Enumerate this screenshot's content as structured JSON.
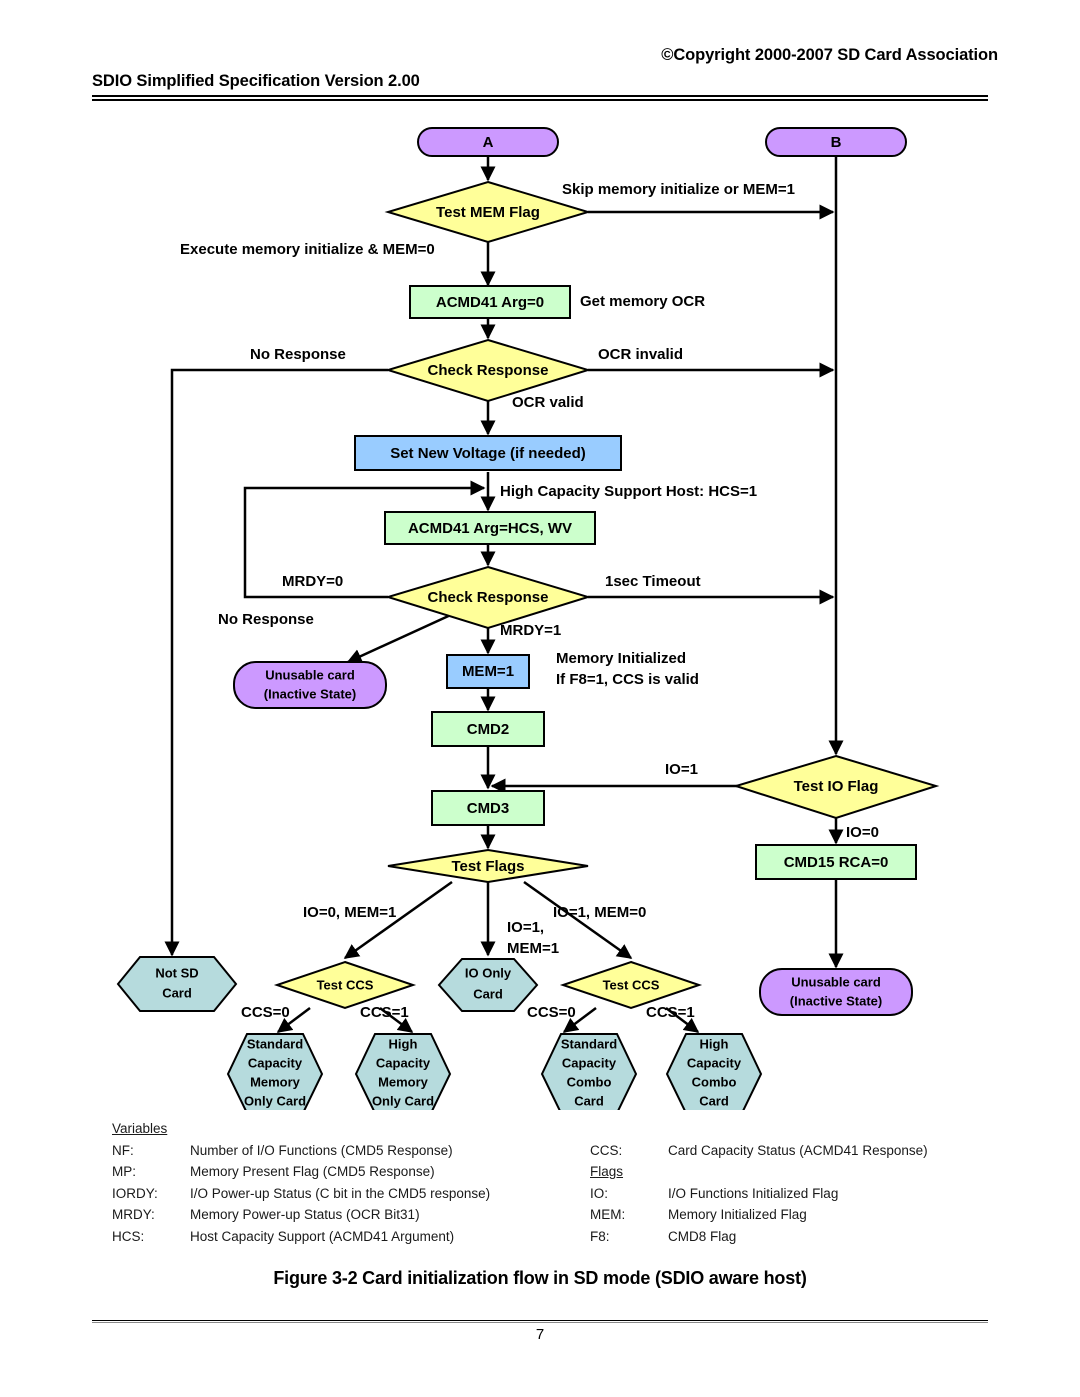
{
  "header": {
    "copyright": "©Copyright 2000-2007 SD Card Association",
    "title": "SDIO Simplified Specification Version 2.00"
  },
  "footer": {
    "figure_caption": "Figure 3-2 Card initialization flow in SD mode (SDIO aware host)",
    "page_number": "7"
  },
  "colors": {
    "terminator_purple": "#CC99FF",
    "decision_yellow": "#FFFF99",
    "process_green": "#CCFFCC",
    "action_blue": "#99CCFF",
    "result_teal": "#B6DBDD",
    "stroke": "#000000"
  },
  "flow": {
    "nodes": {
      "entry_a": "A",
      "entry_b": "B",
      "test_mem_flag": "Test MEM Flag",
      "acmd41_arg0": "ACMD41 Arg=0",
      "check_response_1": "Check Response",
      "set_new_voltage": "Set New Voltage (if needed)",
      "acmd41_hcs_wv": "ACMD41 Arg=HCS, WV",
      "check_response_2": "Check Response",
      "unusable_card_left_l1": "Unusable card",
      "unusable_card_left_l2": "(Inactive State)",
      "mem_eq_1": "MEM=1",
      "cmd2": "CMD2",
      "cmd3": "CMD3",
      "test_flags": "Test Flags",
      "test_io_flag": "Test IO Flag",
      "cmd15_rca0": "CMD15 RCA=0",
      "unusable_card_right_l1": "Unusable card",
      "unusable_card_right_l2": "(Inactive State)",
      "not_sd_card_l1": "Not SD",
      "not_sd_card_l2": "Card",
      "test_ccs_left": "Test CCS",
      "test_ccs_right": "Test CCS",
      "io_only_card_l1": "IO Only",
      "io_only_card_l2": "Card",
      "std_cap_mem_only_l1": "Standard",
      "std_cap_mem_only_l2": "Capacity",
      "std_cap_mem_only_l3": "Memory",
      "std_cap_mem_only_l4": "Only Card",
      "high_cap_mem_only_l1": "High",
      "high_cap_mem_only_l2": "Capacity",
      "high_cap_mem_only_l3": "Memory",
      "high_cap_mem_only_l4": "Only Card",
      "std_cap_combo_l1": "Standard",
      "std_cap_combo_l2": "Capacity",
      "std_cap_combo_l3": "Combo",
      "std_cap_combo_l4": "Card",
      "high_cap_combo_l1": "High",
      "high_cap_combo_l2": "Capacity",
      "high_cap_combo_l3": "Combo",
      "high_cap_combo_l4": "Card"
    },
    "edges": {
      "skip_memory_init": "Skip memory initialize or MEM=1",
      "execute_memory_init": "Execute memory initialize & MEM=0",
      "get_memory_ocr": "Get memory OCR",
      "no_response_1": "No Response",
      "ocr_invalid": "OCR invalid",
      "ocr_valid": "OCR valid",
      "high_capacity_host": "High Capacity Support Host: HCS=1",
      "mrdy_eq_0": "MRDY=0",
      "timeout_1sec": "1sec Timeout",
      "no_response_2": "No Response",
      "mrdy_eq_1": "MRDY=1",
      "memory_initialized_l1": "Memory Initialized",
      "memory_initialized_l2": "If F8=1, CCS is valid",
      "io_eq_1_right": "IO=1",
      "io_eq_0_right": "IO=0",
      "branch_io0_mem1": "IO=0, MEM=1",
      "branch_io1_mem1_l1": "IO=1,",
      "branch_io1_mem1_l2": "MEM=1",
      "branch_io1_mem0": "IO=1, MEM=0",
      "ccs_eq_0_left": "CCS=0",
      "ccs_eq_1_left": "CCS=1",
      "ccs_eq_0_right": "CCS=0",
      "ccs_eq_1_right": "CCS=1"
    }
  },
  "legend": {
    "variables_heading": "Variables",
    "flags_heading": "Flags",
    "variables": [
      {
        "key": "NF:",
        "desc": "Number of I/O Functions (CMD5 Response)"
      },
      {
        "key": "MP:",
        "desc": "Memory Present Flag (CMD5 Response)"
      },
      {
        "key": "IORDY:",
        "desc": "I/O Power-up Status (C bit in the CMD5 response)"
      },
      {
        "key": "MRDY:",
        "desc": "Memory Power-up Status (OCR Bit31)"
      },
      {
        "key": "HCS:",
        "desc": "Host Capacity Support  (ACMD41 Argument)"
      }
    ],
    "ccs": {
      "key": "CCS:",
      "desc": "Card Capacity Status   (ACMD41 Response)"
    },
    "flags": [
      {
        "key": "IO:",
        "desc": "I/O Functions Initialized Flag"
      },
      {
        "key": "MEM:",
        "desc": "Memory Initialized Flag"
      },
      {
        "key": "F8:",
        "desc": "CMD8 Flag"
      }
    ]
  }
}
